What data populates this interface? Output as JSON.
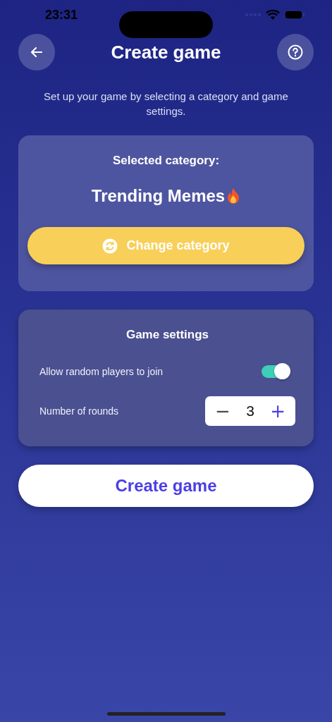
{
  "status_bar": {
    "time": "23:31"
  },
  "header": {
    "title": "Create game"
  },
  "intro": "Set up your game by selecting a category and game settings.",
  "category_card": {
    "label": "Selected category:",
    "category": "Trending Memes",
    "button": "Change category"
  },
  "settings_card": {
    "title": "Game settings",
    "settings": [
      {
        "kind": "toggle",
        "label": "Allow random players to join",
        "on": true
      },
      {
        "kind": "stepper",
        "label": "Number of rounds",
        "value": "3",
        "decrement": "−",
        "increment": "+"
      }
    ]
  },
  "primary_button": "Create game"
}
